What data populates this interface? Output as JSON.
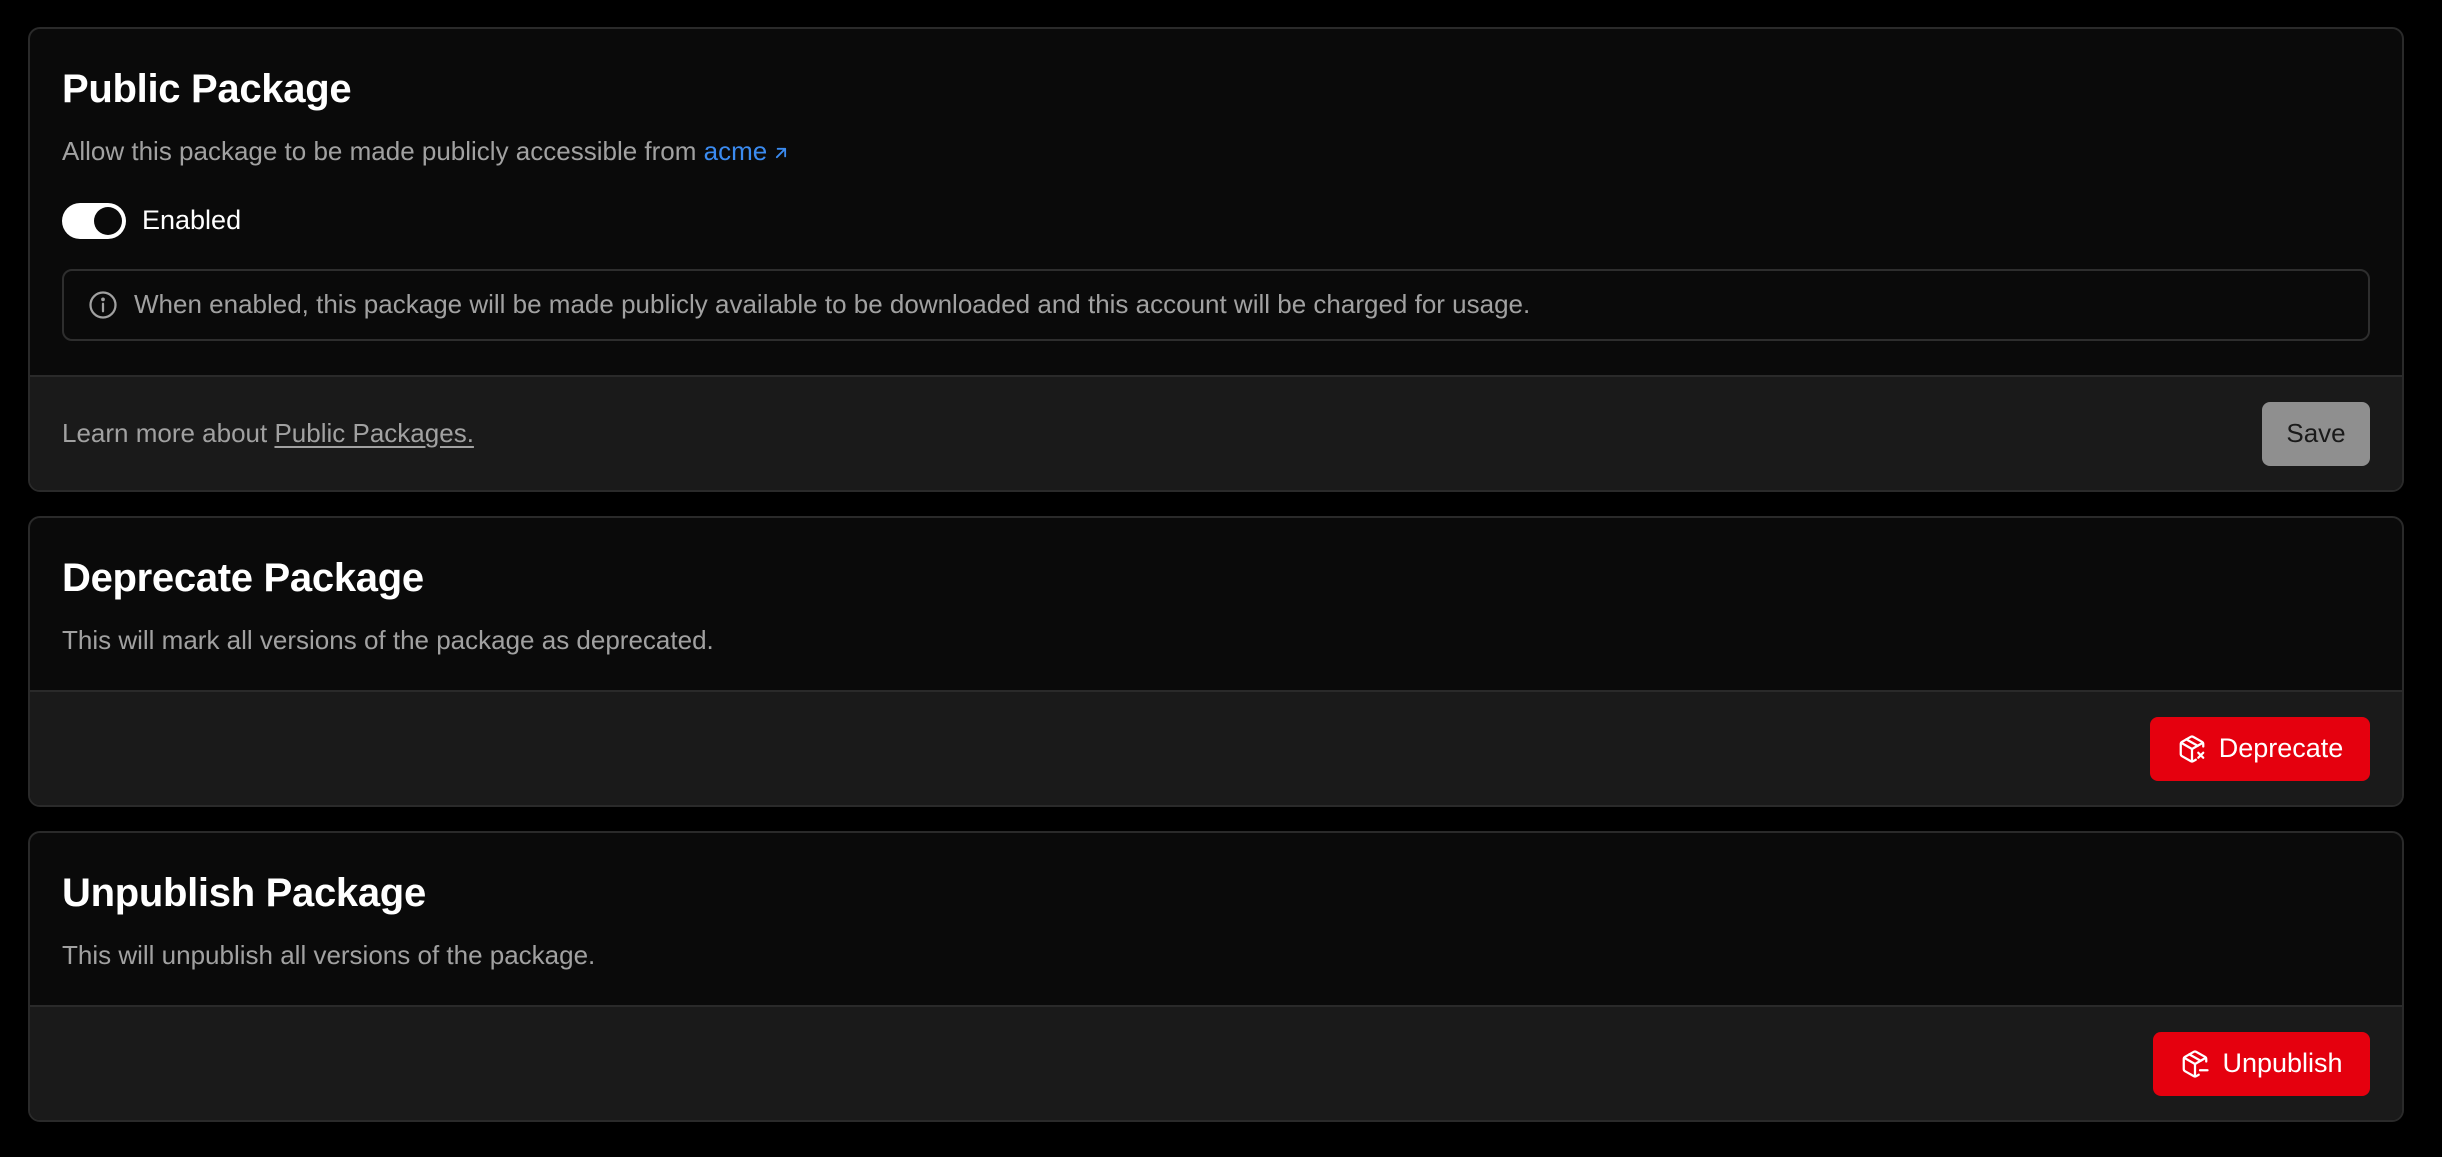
{
  "public_package": {
    "title": "Public Package",
    "description_prefix": "Allow this package to be made publicly accessible from ",
    "link_text": "acme",
    "toggle_label": "Enabled",
    "toggle_on": true,
    "notice": "When enabled, this package will be made publicly available to be downloaded and this account will be charged for usage.",
    "footer_prefix": "Learn more about ",
    "footer_link": "Public Packages.",
    "save_label": "Save"
  },
  "deprecate_package": {
    "title": "Deprecate Package",
    "description": "This will mark all versions of the package as deprecated.",
    "button_label": "Deprecate"
  },
  "unpublish_package": {
    "title": "Unpublish Package",
    "description": "This will unpublish all versions of the package.",
    "button_label": "Unpublish"
  },
  "icons": {
    "link": "arrow-up-right-icon",
    "notice": "info-icon",
    "deprecate": "package-x-icon",
    "unpublish": "package-minus-icon"
  },
  "colors": {
    "background": "#000000",
    "card": "#0a0a0a",
    "footer": "#1a1a1a",
    "link": "#3b8bf0",
    "danger": "#e5000e",
    "save_button": "#8f8f8f"
  }
}
